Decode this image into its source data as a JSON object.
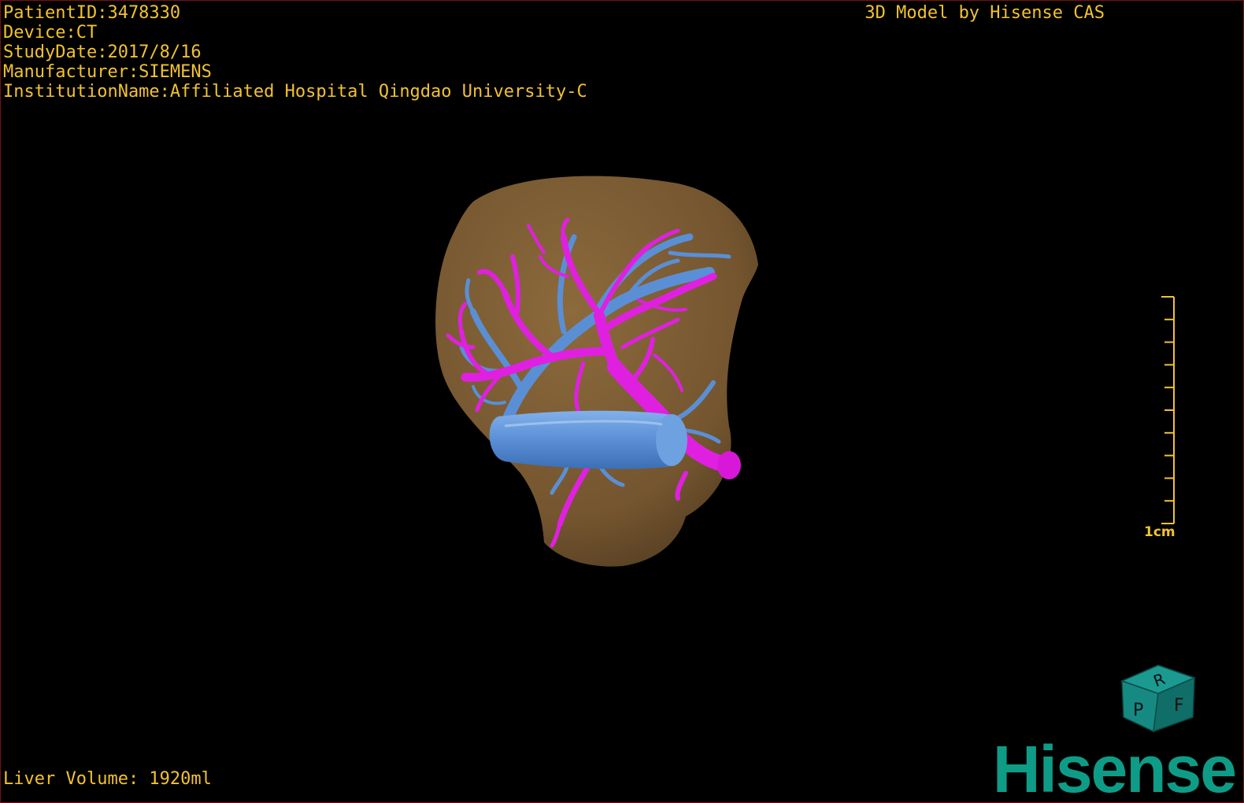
{
  "study_info": {
    "patient_id": "PatientID:3478330",
    "device": "Device:CT",
    "study_date": "StudyDate:2017/8/16",
    "manufacturer": "Manufacturer:SIEMENS",
    "institution": "InstitutionName:Affiliated Hospital Qingdao University-C"
  },
  "model_credit": "3D Model by Hisense CAS",
  "liver_volume": "Liver Volume: 1920ml",
  "scale": {
    "label": "1cm",
    "tick_count": 11
  },
  "orientation_cube": {
    "faces": [
      "R",
      "F",
      "P"
    ]
  },
  "brand": "Hisense",
  "colors": {
    "text": "#f2c230",
    "liver": "#7a5a32",
    "portal_vein": "#e020e0",
    "hepatic_vein": "#5a8fd6",
    "brand": "#0e9c87",
    "cube": "#147d76"
  }
}
